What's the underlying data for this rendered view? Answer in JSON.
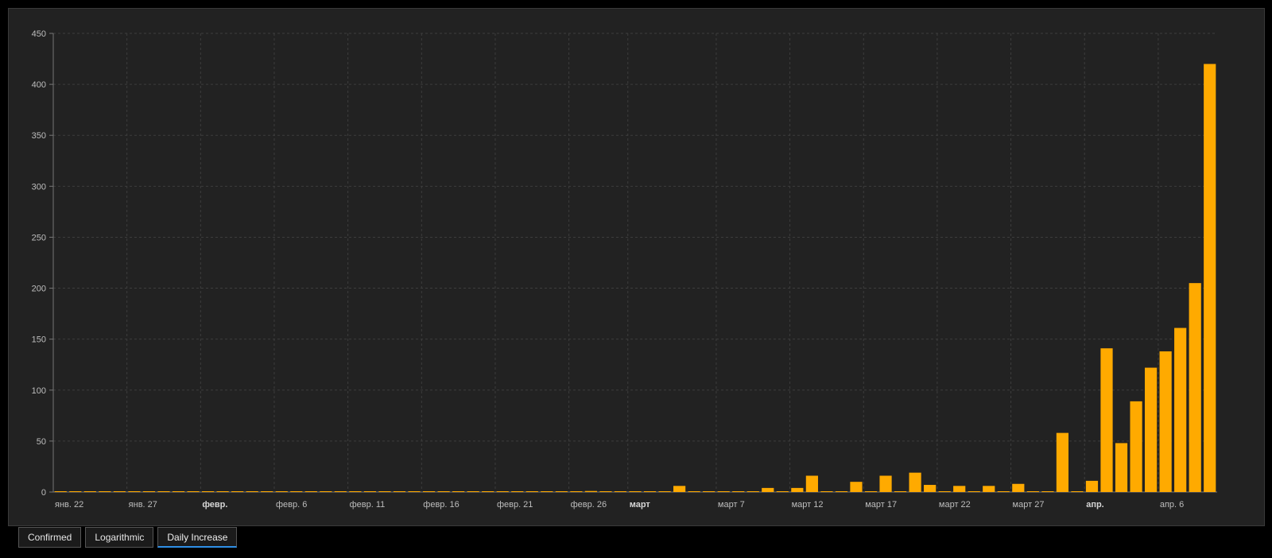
{
  "chart_data": {
    "type": "bar",
    "title": "",
    "xlabel": "",
    "ylabel": "",
    "ylim": [
      0,
      450
    ],
    "yticks": [
      0,
      50,
      100,
      150,
      200,
      250,
      300,
      350,
      400,
      450
    ],
    "grid": true,
    "bar_color": "#FFAA00",
    "x_tick_labels": [
      {
        "index": 0,
        "label": "янв. 22",
        "bold": false
      },
      {
        "index": 5,
        "label": "янв. 27",
        "bold": false
      },
      {
        "index": 10,
        "label": "февр.",
        "bold": true
      },
      {
        "index": 15,
        "label": "февр. 6",
        "bold": false
      },
      {
        "index": 20,
        "label": "февр. 11",
        "bold": false
      },
      {
        "index": 25,
        "label": "февр. 16",
        "bold": false
      },
      {
        "index": 30,
        "label": "февр. 21",
        "bold": false
      },
      {
        "index": 35,
        "label": "февр. 26",
        "bold": false
      },
      {
        "index": 39,
        "label": "март",
        "bold": true
      },
      {
        "index": 45,
        "label": "март 7",
        "bold": false
      },
      {
        "index": 50,
        "label": "март 12",
        "bold": false
      },
      {
        "index": 55,
        "label": "март 17",
        "bold": false
      },
      {
        "index": 60,
        "label": "март 22",
        "bold": false
      },
      {
        "index": 65,
        "label": "март 27",
        "bold": false
      },
      {
        "index": 70,
        "label": "апр.",
        "bold": true
      },
      {
        "index": 75,
        "label": "апр. 6",
        "bold": false
      }
    ],
    "values": [
      0,
      0,
      0,
      0,
      0,
      0,
      0,
      0,
      0,
      0,
      0,
      0,
      0,
      0,
      0,
      0,
      0,
      0,
      0,
      0,
      0,
      0,
      0,
      0,
      0,
      0,
      0,
      0,
      0,
      0,
      0,
      0,
      0,
      0,
      0,
      0,
      1,
      0,
      0,
      0,
      0,
      0,
      6,
      0,
      0,
      0,
      0,
      0,
      4,
      0,
      4,
      16,
      0,
      0,
      10,
      0,
      16,
      0,
      19,
      7,
      0,
      6,
      0,
      6,
      0,
      8,
      0,
      0,
      58,
      0,
      11,
      141,
      48,
      89,
      122,
      138,
      161,
      205,
      420
    ]
  },
  "tabs": [
    {
      "label": "Confirmed",
      "active": false
    },
    {
      "label": "Logarithmic",
      "active": false
    },
    {
      "label": "Daily Increase",
      "active": true
    }
  ]
}
